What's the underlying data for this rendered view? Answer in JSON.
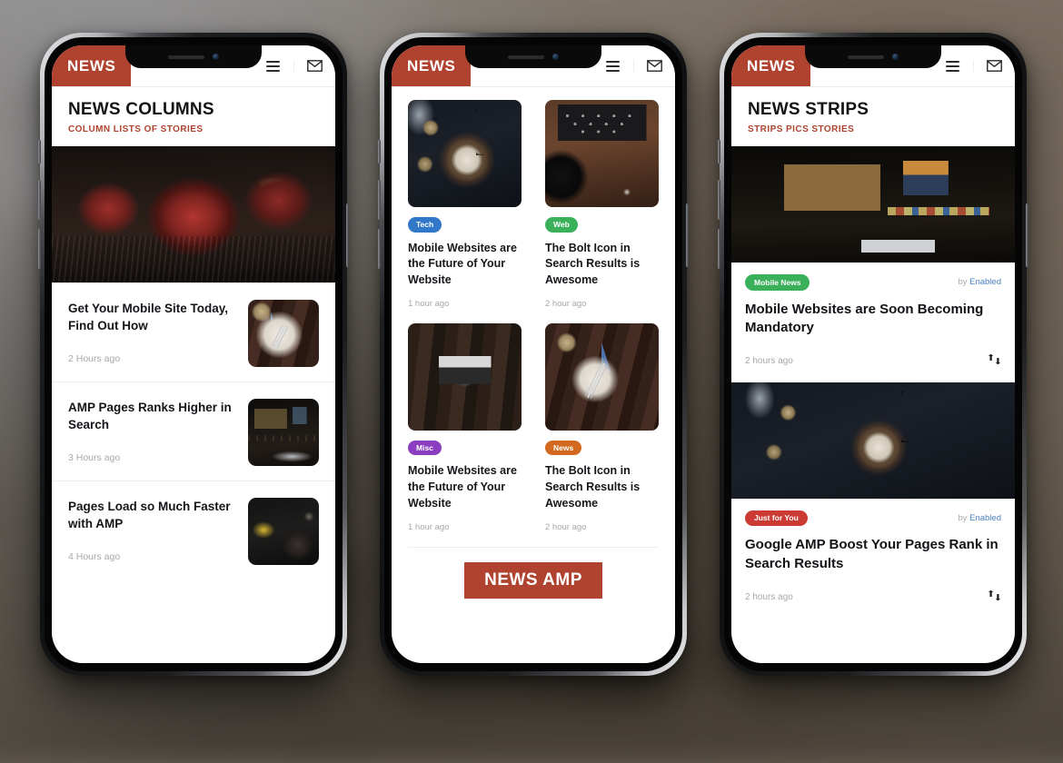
{
  "brand": {
    "logo_label": "NEWS",
    "accent_color": "#b0432f"
  },
  "icons": {
    "menu": "hamburger-menu-icon",
    "mail": "envelope-icon",
    "share": "retweet-share-icon"
  },
  "phone1": {
    "page_title": "NEWS COLUMNS",
    "page_subtitle": "COLUMN LISTS OF STORIES",
    "hero_image": "strawberries-on-dark-wood",
    "items": [
      {
        "title": "Get Your Mobile Site Today, Find Out How",
        "ago": "2 Hours ago",
        "thumb": "plate-with-fork-and-blue-book"
      },
      {
        "title": "AMP Pages Ranks Higher in Search",
        "ago": "3 Hours ago",
        "thumb": "dark-desk-with-keyboard"
      },
      {
        "title": "Pages Load so Much Faster with AMP",
        "ago": "4 Hours ago",
        "thumb": "pan-with-food-and-flowers"
      }
    ]
  },
  "phone2": {
    "cards": [
      {
        "image": "dark-food-flatlay",
        "badge": "Tech",
        "badge_color": "#3278c8",
        "title": "Mobile Websites are the Future of Your Website",
        "ago": "1 hour ago"
      },
      {
        "image": "vintage-typewriter-desk",
        "badge": "Web",
        "badge_color": "#3ab05a",
        "title": "The Bolt Icon in Search Results is Awesome",
        "ago": "2 hour ago"
      },
      {
        "image": "vintage-camera-on-wood",
        "badge": "Misc",
        "badge_color": "#8b3fc0",
        "title": "Mobile Websites are the Future of Your Website",
        "ago": "1 hour ago"
      },
      {
        "image": "plate-fork-coffee-book",
        "badge": "News",
        "badge_color": "#d2691e",
        "title": "The Bolt Icon in Search Results is Awesome",
        "ago": "2 hour ago"
      }
    ],
    "footer_button": "NEWS AMP"
  },
  "phone3": {
    "page_title": "NEWS STRIPS",
    "page_subtitle": "STRIPS PICS STORIES",
    "strips": [
      {
        "image": "dark-workstation-monitors",
        "badge": "Mobile News",
        "badge_color": "#3ab05a",
        "byline_prefix": "by",
        "byline_author": "Enabled",
        "title": "Mobile Websites are Soon Becoming Mandatory",
        "ago": "2 hours ago"
      },
      {
        "image": "dark-food-flatlay",
        "badge": "Just for You",
        "badge_color": "#cc3b33",
        "byline_prefix": "by",
        "byline_author": "Enabled",
        "title": "Google AMP Boost Your Pages Rank in Search Results",
        "ago": "2 hours ago"
      }
    ]
  }
}
